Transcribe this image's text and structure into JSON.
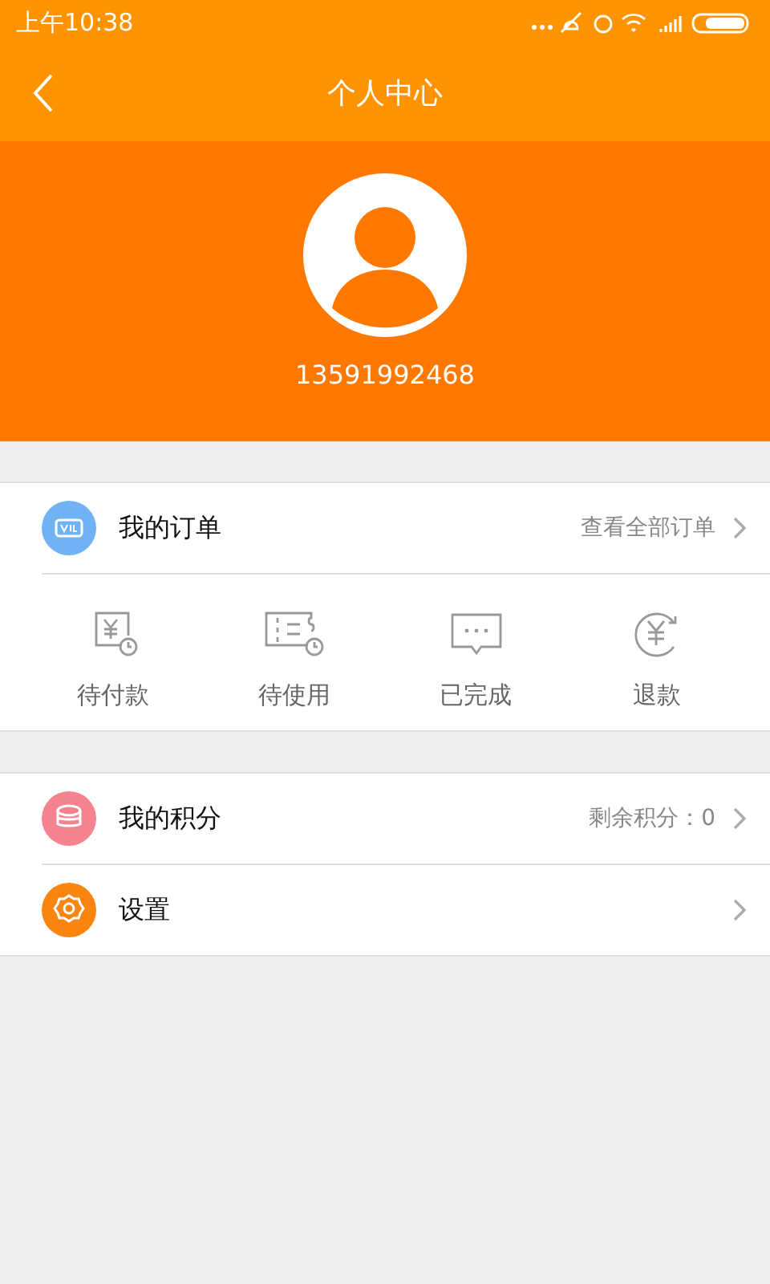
{
  "status_bar": {
    "time": "上午10:38"
  },
  "nav": {
    "title": "个人中心"
  },
  "profile": {
    "phone": "13591992468"
  },
  "orders": {
    "title": "我的订单",
    "link": "查看全部订单",
    "color": "#6fb3f5",
    "items": [
      {
        "kind": "pay",
        "label": "待付款"
      },
      {
        "kind": "use",
        "label": "待使用"
      },
      {
        "kind": "done",
        "label": "已完成"
      },
      {
        "kind": "refund",
        "label": "退款"
      }
    ]
  },
  "menu": [
    {
      "kind": "points",
      "title": "我的积分",
      "value": "剩余积分：0",
      "color": "#f5838f"
    },
    {
      "kind": "settings",
      "title": "设置",
      "color": "#f98410"
    }
  ]
}
